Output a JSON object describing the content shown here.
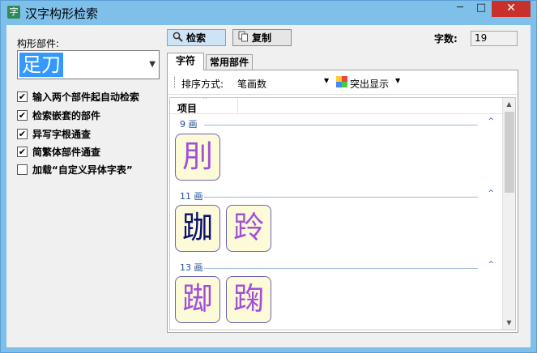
{
  "window": {
    "app_icon": "字",
    "title": "汉字构形检索",
    "min_glyph": "─",
    "max_glyph": "□",
    "close_glyph": "✕"
  },
  "left": {
    "parts_label": "构形部件:",
    "parts_value": "足刀",
    "options": [
      {
        "label": "输入两个部件起自动检索",
        "checked": true
      },
      {
        "label": "检索嵌套的部件",
        "checked": true
      },
      {
        "label": "异写字根通查",
        "checked": true
      },
      {
        "label": "简繁体部件通查",
        "checked": true
      },
      {
        "label": "加载“自定义异体字表”",
        "checked": false
      }
    ]
  },
  "toolbar": {
    "search_label": "检索",
    "copy_label": "复制",
    "count_label": "字数:",
    "count_value": "19"
  },
  "tabs": [
    {
      "label": "字符",
      "active": true
    },
    {
      "label": "常用部件",
      "active": false
    }
  ],
  "sortbar": {
    "sort_label": "排序方式:",
    "sort_value": "笔画数",
    "highlight_label": "突出显示"
  },
  "list": {
    "column_header": "项目",
    "groups": [
      {
        "label": "9 画",
        "chars": [
          {
            "ch": "刖",
            "shade": "light"
          }
        ]
      },
      {
        "label": "11 画",
        "chars": [
          {
            "ch": "跏",
            "shade": "dark"
          },
          {
            "ch": "跉",
            "shade": "light"
          }
        ]
      },
      {
        "label": "13 画",
        "chars": [
          {
            "ch": "踋",
            "shade": "light"
          },
          {
            "ch": "踘",
            "shade": "light"
          }
        ]
      }
    ]
  },
  "icons": {
    "search": "magnifier-icon",
    "copy": "copy-icon",
    "highlight": "palette-icon"
  },
  "colors": {
    "title_bar": "#7fc0eb",
    "close_button": "#c7312a",
    "selection": "#3399ff",
    "group_label": "#1f4e9a",
    "glyph_bg": "#fdfad8"
  }
}
